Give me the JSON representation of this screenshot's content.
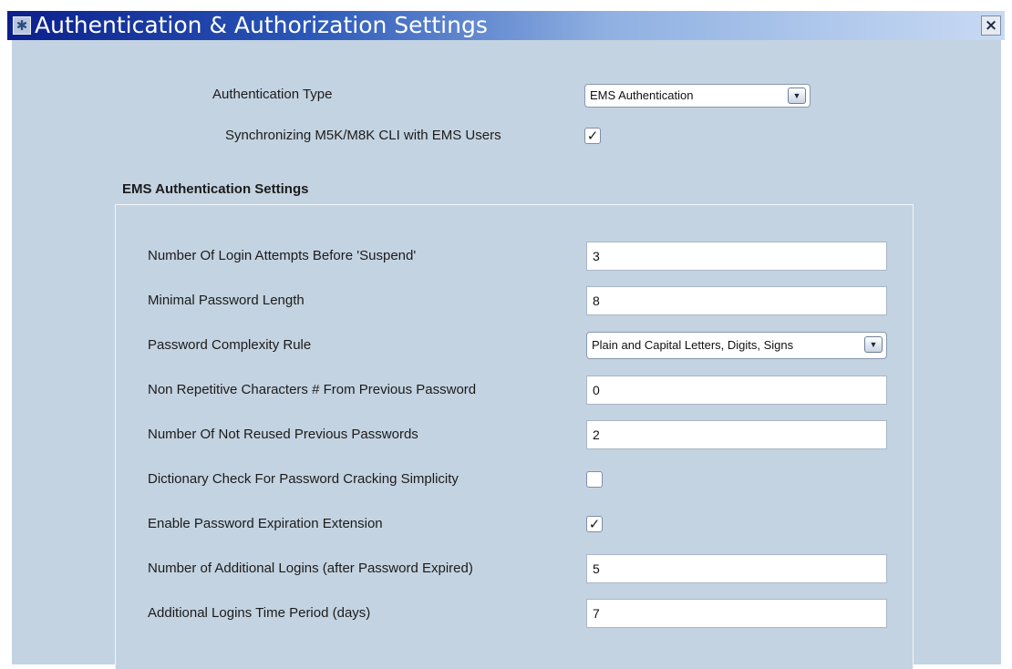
{
  "window": {
    "title": "Authentication & Authorization Settings",
    "close_glyph": "×",
    "app_icon": "settings-app-icon",
    "icon_glyph": "✱"
  },
  "top": {
    "auth_type_label": "Authentication Type",
    "auth_type_value": "EMS Authentication",
    "sync_label": "Synchronizing M5K/M8K CLI with EMS Users",
    "sync_checked": true
  },
  "group": {
    "title": "EMS Authentication Settings",
    "rows": [
      {
        "label": "Number Of Login Attempts Before 'Suspend'",
        "type": "text",
        "value": "3"
      },
      {
        "label": "Minimal Password Length",
        "type": "text",
        "value": "8"
      },
      {
        "label": "Password Complexity Rule",
        "type": "select",
        "value": "Plain and Capital Letters, Digits, Signs"
      },
      {
        "label": "Non Repetitive Characters # From Previous Password",
        "type": "text",
        "value": "0"
      },
      {
        "label": "Number Of Not Reused Previous Passwords",
        "type": "text",
        "value": "2"
      },
      {
        "label": "Dictionary Check For Password Cracking Simplicity",
        "type": "checkbox",
        "checked": false
      },
      {
        "label": "Enable Password Expiration Extension",
        "type": "checkbox",
        "checked": true
      },
      {
        "label": "Number of Additional Logins (after Password Expired)",
        "type": "text",
        "value": "5"
      },
      {
        "label": "Additional Logins Time Period (days)",
        "type": "text",
        "value": "7"
      }
    ]
  },
  "glyphs": {
    "check": "✓",
    "dropdown_arrow": "▼"
  },
  "colors": {
    "panel_bg": "#c4d3e1",
    "titlebar_start": "#0b1f8c",
    "titlebar_end": "#c8daf3"
  }
}
